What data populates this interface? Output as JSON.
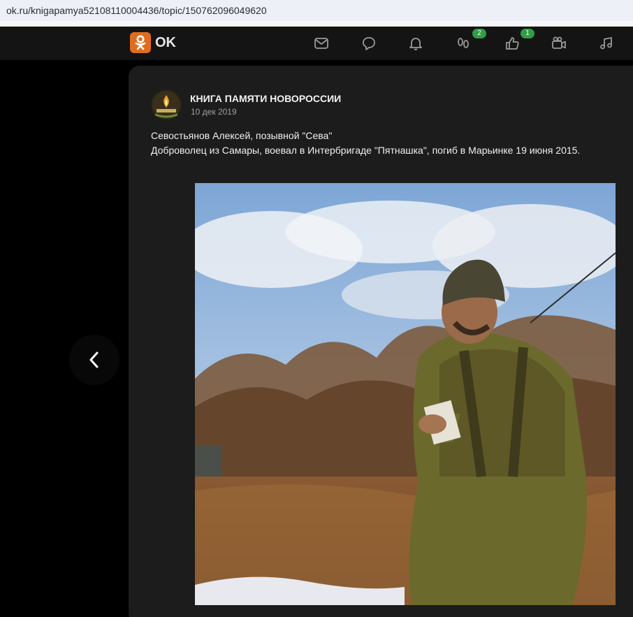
{
  "browser": {
    "url": "ok.ru/knigapamya52108110004436/topic/150762096049620"
  },
  "nav": {
    "logo_text": "OK",
    "icons": [
      {
        "name": "mail-icon",
        "badge": ""
      },
      {
        "name": "discussions-icon",
        "badge": ""
      },
      {
        "name": "bell-icon",
        "badge": ""
      },
      {
        "name": "guests-icon",
        "badge": "2"
      },
      {
        "name": "likes-icon",
        "badge": "1"
      },
      {
        "name": "video-icon",
        "badge": ""
      },
      {
        "name": "music-icon",
        "badge": ""
      }
    ],
    "badge_color": "#2e9e45",
    "brand_color": "#e06d1f"
  },
  "post": {
    "group_name": "КНИГА ПАМЯТИ НОВОРОССИИ",
    "date": "10 дек 2019",
    "line1": "Севостьянов Алексей, позывной \"Сева\"",
    "line2": "Доброволец из Самары, воевал в Интербригаде \"Пятнашка\", погиб в Марьинке 19 июня 2015."
  },
  "photo": {
    "description_icon": "photo-soldier-in-field"
  },
  "controls": {
    "back_icon": "chevron-left-icon"
  }
}
